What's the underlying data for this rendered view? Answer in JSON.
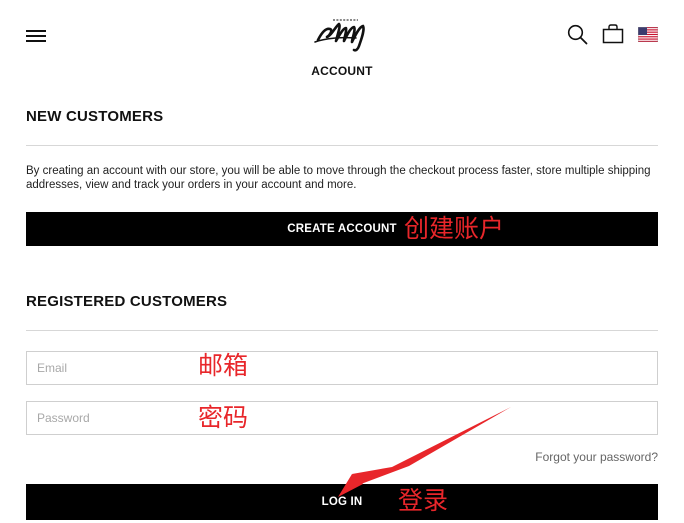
{
  "header": {
    "title": "ACCOUNT",
    "logo_text": "Stussy",
    "icons": {
      "menu": "hamburger-menu-icon",
      "search": "search-icon",
      "bag": "shopping-bag-icon",
      "flag": "us-flag-icon"
    }
  },
  "new_customers": {
    "heading": "NEW CUSTOMERS",
    "description": "By creating an account with our store, you will be able to move through the checkout process faster, store multiple shipping addresses, view and track your orders in your account and more.",
    "create_account_label": "CREATE ACCOUNT"
  },
  "registered_customers": {
    "heading": "REGISTERED CUSTOMERS",
    "email_placeholder": "Email",
    "email_value": "",
    "password_placeholder": "Password",
    "password_value": "",
    "forgot_password_label": "Forgot your password?",
    "login_label": "LOG IN"
  },
  "annotations": {
    "create_account": "创建账户",
    "email": "邮箱",
    "password": "密码",
    "login": "登录"
  },
  "colors": {
    "button_bg": "#000000",
    "annotation": "#e8262a",
    "divider": "#d7d7d7"
  }
}
